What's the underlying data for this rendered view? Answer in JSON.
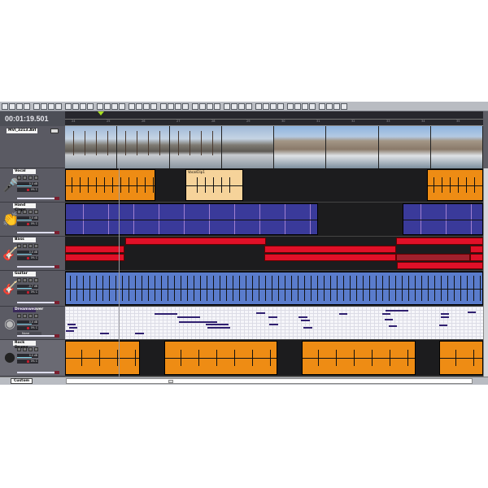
{
  "transport": {
    "time": "00:01:19.501"
  },
  "ruler": {
    "bars": [
      "24",
      "25",
      "26",
      "27",
      "28",
      "29",
      "30",
      "31",
      "32",
      "33",
      "34",
      "35"
    ]
  },
  "video": {
    "name": "MVI_3213.AVI"
  },
  "clips": {
    "vocal_selected": "VocalClip1"
  },
  "tracks": [
    {
      "name": "Vocal",
      "icon": "microphone-icon",
      "glyph": "🎤",
      "volume": "0.0 dB",
      "pan": "0% C"
    },
    {
      "name": "Hand Claps",
      "icon": "hand-claps-icon",
      "glyph": "👏",
      "volume": "0.0 dB",
      "pan": "0% C"
    },
    {
      "name": "Bass",
      "icon": "bass-guitar-icon",
      "glyph": "🎸",
      "volume": "0.0 dB",
      "pan": "0% C"
    },
    {
      "name": "Guitar",
      "icon": "guitar-icon",
      "glyph": "🎸",
      "volume": "-0.7 dB",
      "pan": "0% C"
    },
    {
      "name": "Dreamweaver",
      "icon": "midi-port-icon",
      "glyph": "◉",
      "volume": "0.0 dB",
      "pan": "0% C",
      "channel": "None"
    },
    {
      "name": "Rock Drums",
      "icon": "drum-icon",
      "glyph": "●",
      "volume": "0.0 dB",
      "pan": "0% C"
    }
  ],
  "bottom": {
    "tab": "Custom"
  }
}
